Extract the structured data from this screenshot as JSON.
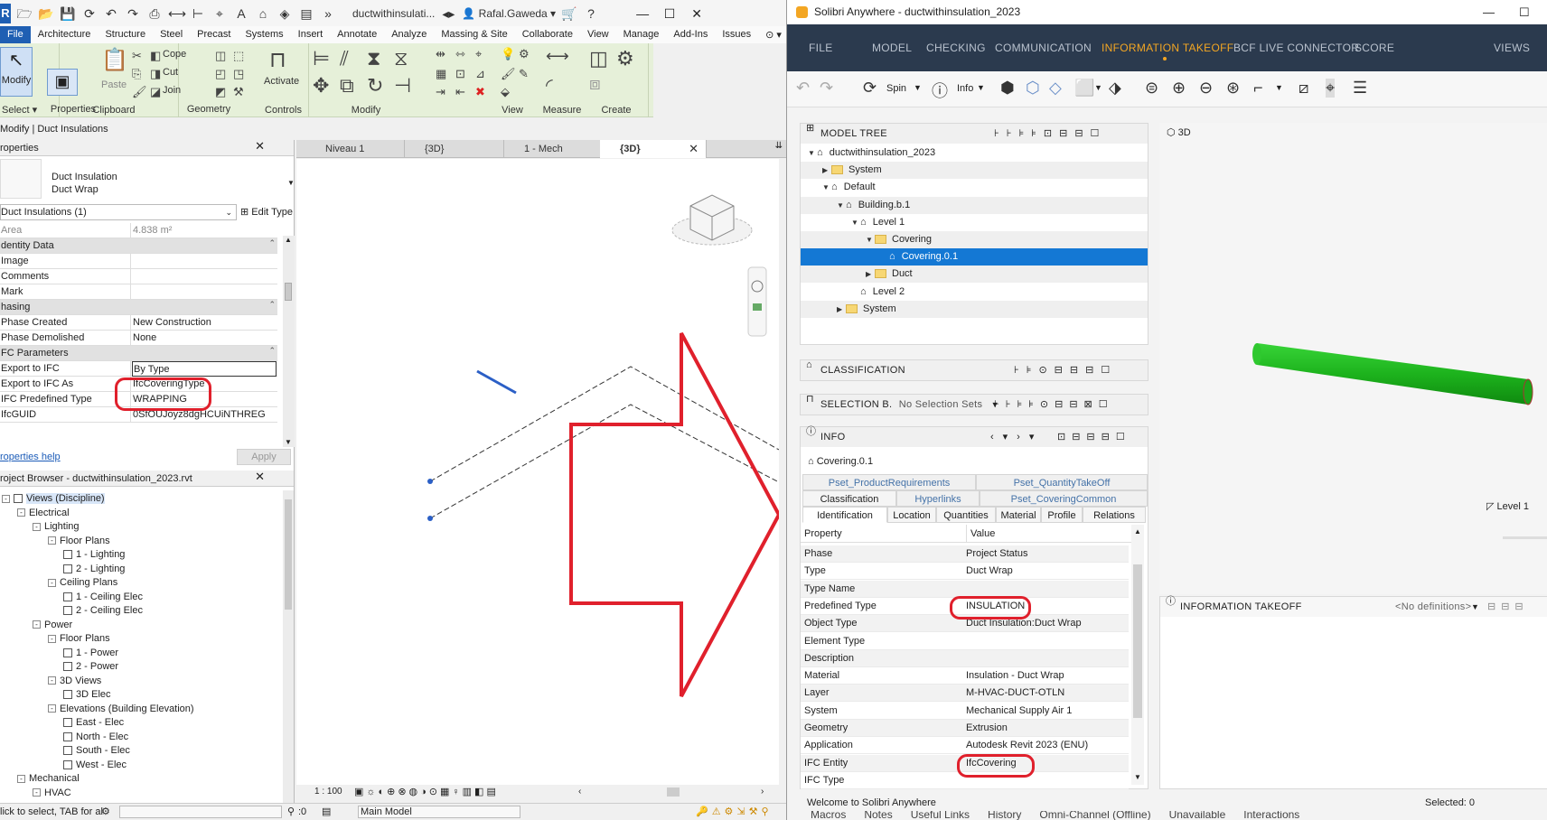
{
  "revit": {
    "doc_title": "ductwithinsulati...",
    "user": "Rafal.Gaweda",
    "menu": [
      "File",
      "Architecture",
      "Structure",
      "Steel",
      "Precast",
      "Systems",
      "Insert",
      "Annotate",
      "Analyze",
      "Massing & Site",
      "Collaborate",
      "View",
      "Manage",
      "Add-Ins",
      "Issues"
    ],
    "ribbon": {
      "groups": [
        "Select",
        "Properties",
        "Clipboard",
        "Geometry",
        "Controls",
        "Modify",
        "View",
        "Measure",
        "Create"
      ],
      "modify_label": "Modify",
      "paste_label": "Paste",
      "cope_label": "Cope",
      "cut_label": "Cut",
      "join_label": "Join",
      "activate_label": "Activate"
    },
    "context_title": "Modify | Duct Insulations",
    "properties": {
      "title": "roperties",
      "type_family": "Duct Insulation",
      "type_name": "Duct Wrap",
      "selector": "Duct Insulations (1)",
      "edit_type": "Edit Type",
      "rows": [
        {
          "k": "Area",
          "v": "4.838 m²",
          "group": false,
          "dim": true
        },
        {
          "k": "dentity Data",
          "v": "",
          "group": true
        },
        {
          "k": "Image",
          "v": "",
          "group": false
        },
        {
          "k": "Comments",
          "v": "",
          "group": false
        },
        {
          "k": "Mark",
          "v": "",
          "group": false
        },
        {
          "k": "hasing",
          "v": "",
          "group": true
        },
        {
          "k": "Phase Created",
          "v": "New Construction",
          "group": false
        },
        {
          "k": "Phase Demolished",
          "v": "None",
          "group": false
        },
        {
          "k": "FC Parameters",
          "v": "",
          "group": true
        },
        {
          "k": "Export to IFC",
          "v": "By Type",
          "group": false
        },
        {
          "k": "Export to IFC As",
          "v": "IfcCoveringType",
          "group": false
        },
        {
          "k": "IFC Predefined Type",
          "v": "WRAPPING",
          "group": false
        },
        {
          "k": "IfcGUID",
          "v": "0SfOUJoyz8dgHCUiNTHREG",
          "group": false
        }
      ],
      "help_link": "roperties help",
      "apply": "Apply"
    },
    "browser": {
      "title": "roject Browser - ductwithinsulation_2023.rvt",
      "nodes": [
        {
          "t": "Views (Discipline)",
          "lvl": 0,
          "tog": "-",
          "kind": "views",
          "sel": true
        },
        {
          "t": "Electrical",
          "lvl": 1,
          "tog": "-"
        },
        {
          "t": "Lighting",
          "lvl": 2,
          "tog": "-"
        },
        {
          "t": "Floor Plans",
          "lvl": 3,
          "tog": "-"
        },
        {
          "t": "1 - Lighting",
          "lvl": 4,
          "kind": "view"
        },
        {
          "t": "2 - Lighting",
          "lvl": 4,
          "kind": "view"
        },
        {
          "t": "Ceiling Plans",
          "lvl": 3,
          "tog": "-"
        },
        {
          "t": "1 - Ceiling Elec",
          "lvl": 4,
          "kind": "view"
        },
        {
          "t": "2 - Ceiling Elec",
          "lvl": 4,
          "kind": "view"
        },
        {
          "t": "Power",
          "lvl": 2,
          "tog": "-"
        },
        {
          "t": "Floor Plans",
          "lvl": 3,
          "tog": "-"
        },
        {
          "t": "1 - Power",
          "lvl": 4,
          "kind": "view"
        },
        {
          "t": "2 - Power",
          "lvl": 4,
          "kind": "view"
        },
        {
          "t": "3D Views",
          "lvl": 3,
          "tog": "-"
        },
        {
          "t": "3D Elec",
          "lvl": 4,
          "kind": "view"
        },
        {
          "t": "Elevations (Building Elevation)",
          "lvl": 3,
          "tog": "-"
        },
        {
          "t": "East - Elec",
          "lvl": 4,
          "kind": "view"
        },
        {
          "t": "North - Elec",
          "lvl": 4,
          "kind": "view"
        },
        {
          "t": "South - Elec",
          "lvl": 4,
          "kind": "view"
        },
        {
          "t": "West - Elec",
          "lvl": 4,
          "kind": "view"
        },
        {
          "t": "Mechanical",
          "lvl": 1,
          "tog": "-"
        },
        {
          "t": "HVAC",
          "lvl": 2,
          "tog": "-"
        }
      ]
    },
    "view_tabs": [
      "Niveau 1",
      "{3D}",
      "1 - Mech",
      "{3D}"
    ],
    "view_scale": "1 : 100",
    "status_text": "lick to select, TAB for al",
    "status_count": ":0",
    "status_model": "Main Model"
  },
  "solibri": {
    "title": "Solibri Anywhere - ductwithinsulation_2023",
    "nav": [
      "FILE",
      "MODEL",
      "CHECKING",
      "COMMUNICATION",
      "INFORMATION TAKEOFF",
      "BCF LIVE CONNECTOR",
      "SCORE",
      "VIEWS"
    ],
    "active_nav": "INFORMATION TAKEOFF",
    "toolbar": {
      "spin": "Spin",
      "info": "Info"
    },
    "model_tree": {
      "title": "MODEL TREE",
      "nodes": [
        {
          "t": "ductwithinsulation_2023",
          "lvl": 0,
          "tw": "▼"
        },
        {
          "t": "System",
          "lvl": 1,
          "tw": "▶",
          "folder": true,
          "alt": true
        },
        {
          "t": "Default",
          "lvl": 1,
          "tw": "▼"
        },
        {
          "t": "Building.b.1",
          "lvl": 2,
          "tw": "▼",
          "alt": true
        },
        {
          "t": "Level 1",
          "lvl": 3,
          "tw": "▼"
        },
        {
          "t": "Covering",
          "lvl": 4,
          "tw": "▼",
          "folder": true,
          "alt": true
        },
        {
          "t": "Covering.0.1",
          "lvl": 5,
          "tw": "",
          "sel": true
        },
        {
          "t": "Duct",
          "lvl": 4,
          "tw": "▶",
          "folder": true,
          "alt": true
        },
        {
          "t": "Level 2",
          "lvl": 3,
          "tw": ""
        },
        {
          "t": "System",
          "lvl": 2,
          "tw": "▶",
          "folder": true,
          "alt": true
        }
      ]
    },
    "classification_title": "CLASSIFICATION",
    "selection": {
      "title": "SELECTION B.",
      "value": "No Selection Sets"
    },
    "info": {
      "title": "INFO",
      "object": "Covering.0.1",
      "tabs_row1": [
        "Pset_ProductRequirements",
        "Pset_QuantityTakeOff"
      ],
      "tabs_row2": [
        "Classification",
        "Hyperlinks",
        "Pset_CoveringCommon"
      ],
      "tabs_row3": [
        "Identification",
        "Location",
        "Quantities",
        "Material",
        "Profile",
        "Relations"
      ],
      "col_property": "Property",
      "col_value": "Value",
      "rows": [
        {
          "k": "Phase",
          "v": "Project Status"
        },
        {
          "k": "Type",
          "v": "Duct Wrap"
        },
        {
          "k": "Type Name",
          "v": ""
        },
        {
          "k": "Predefined Type",
          "v": "INSULATION"
        },
        {
          "k": "Object Type",
          "v": "Duct Insulation:Duct Wrap"
        },
        {
          "k": "Element Type",
          "v": ""
        },
        {
          "k": "Description",
          "v": ""
        },
        {
          "k": "Material",
          "v": "Insulation - Duct Wrap"
        },
        {
          "k": "Layer",
          "v": "M-HVAC-DUCT-OTLN"
        },
        {
          "k": "System",
          "v": "Mechanical Supply Air 1"
        },
        {
          "k": "Geometry",
          "v": "Extrusion"
        },
        {
          "k": "Application",
          "v": "Autodesk Revit 2023 (ENU)"
        },
        {
          "k": "IFC Entity",
          "v": "IfcCovering"
        },
        {
          "k": "IFC Type",
          "v": ""
        }
      ]
    },
    "view3d_label": "3D",
    "level_label": "Level 1",
    "takeoff": {
      "title": "INFORMATION TAKEOFF",
      "definitions": "<No definitions>"
    },
    "status_welcome": "Welcome to Solibri Anywhere",
    "status_selected": "Selected: 0",
    "under_taskbar": "Macros      Notes      Useful Links      History      Omni-Channel (Offline)      Unavailable      Interactions"
  },
  "colors": {
    "accent": "#f3a623",
    "nav_bg": "#2b3a4e",
    "selection": "#1478d4",
    "annotation": "#e0202c",
    "duct": "#22b422",
    "revit_blue": "#1f5fb3"
  }
}
